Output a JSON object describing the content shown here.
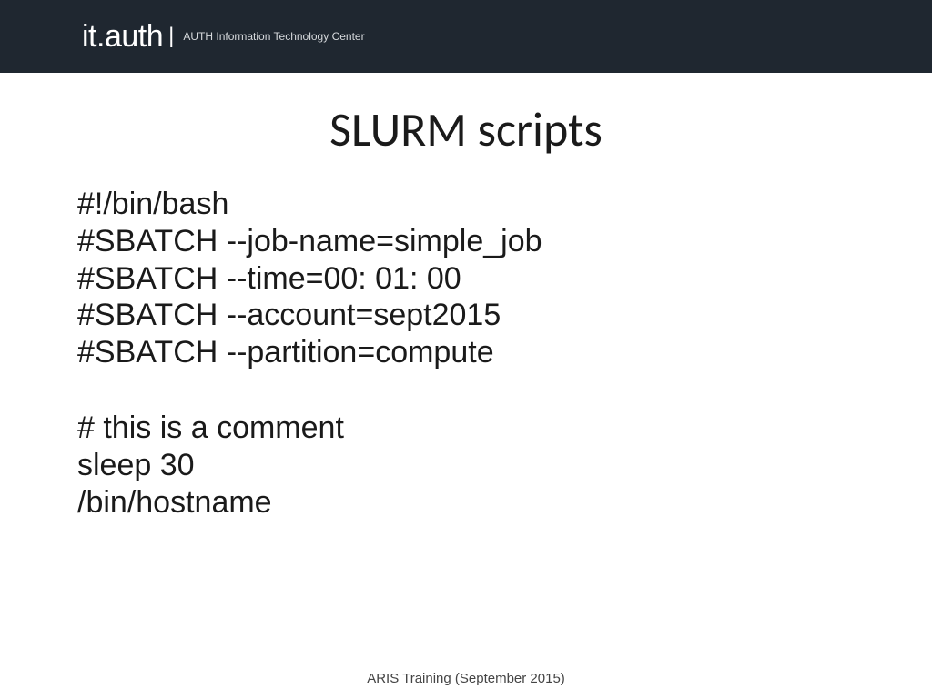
{
  "header": {
    "logo_it": "it",
    "logo_dot": ".",
    "logo_auth": "auth",
    "logo_sep": "|",
    "tagline": "AUTH Information Technology Center"
  },
  "slide": {
    "title": "SLURM scripts"
  },
  "script": {
    "line1": "#!/bin/bash",
    "line2": "#SBATCH --job-name=simple_job",
    "line3": "#SBATCH --time=00: 01: 00",
    "line4": "#SBATCH --account=sept2015",
    "line5": "#SBATCH --partition=compute",
    "line6": "# this is a comment",
    "line7": "sleep 30",
    "line8": "/bin/hostname"
  },
  "footer": {
    "text": "ARIS Training (September 2015)"
  }
}
